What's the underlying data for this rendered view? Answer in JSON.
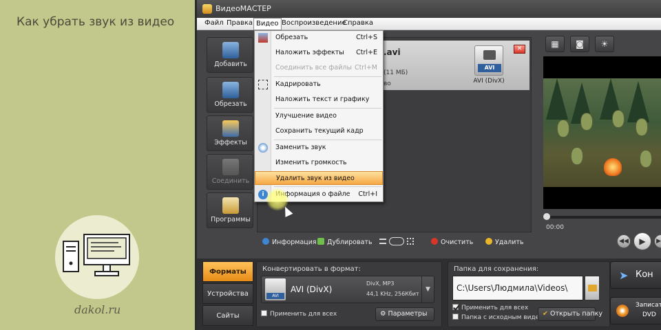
{
  "page": {
    "heading": "Как убрать звук из видео",
    "site": "dakol.ru"
  },
  "window": {
    "title": "ВидеоМАСТЕР"
  },
  "menubar": {
    "items": [
      "Файл",
      "Правка",
      "Видео",
      "Воспроизведение",
      "Справка"
    ],
    "active": "Видео"
  },
  "toolbar": {
    "buttons": [
      {
        "label": "Добавить",
        "icon": "add-film-icon",
        "enabled": true
      },
      {
        "label": "Обрезать",
        "icon": "scissors-film-icon",
        "enabled": true
      },
      {
        "label": "Эффекты",
        "icon": "effects-film-icon",
        "enabled": true
      },
      {
        "label": "Соединить",
        "icon": "join-film-icon",
        "enabled": false
      },
      {
        "label": "Программы",
        "icon": "programs-icon",
        "enabled": true
      }
    ]
  },
  "file": {
    "name": ".avi",
    "size": "(11 МБ)",
    "extra": "во",
    "format_label": "AVI (DivX)",
    "badge": "AVI"
  },
  "dropdown": {
    "items": [
      {
        "label": "Обрезать",
        "shortcut": "Ctrl+S"
      },
      {
        "label": "Наложить эффекты",
        "shortcut": "Ctrl+E"
      },
      {
        "label": "Соединить все файлы",
        "shortcut": "Ctrl+M",
        "disabled": true
      },
      {
        "label": "Кадрировать",
        "shortcut": ""
      },
      {
        "label": "Наложить текст и графику",
        "shortcut": ""
      },
      {
        "label": "Улучшение видео",
        "shortcut": ""
      },
      {
        "label": "Сохранить текущий кадр",
        "shortcut": ""
      },
      {
        "label": "Заменить звук",
        "shortcut": ""
      },
      {
        "label": "Изменить громкость",
        "shortcut": ""
      },
      {
        "label": "Удалить звук из видео",
        "shortcut": "",
        "highlighted": true
      },
      {
        "label": "Информация о файле",
        "shortcut": "Ctrl+I"
      }
    ]
  },
  "actions": {
    "info": "Информация",
    "duplicate": "Дублировать",
    "clear": "Очистить",
    "delete": "Удалить"
  },
  "player": {
    "time": "00:00"
  },
  "bottom": {
    "tabs": [
      "Форматы",
      "Устройства",
      "Сайты"
    ],
    "active_tab": "Форматы",
    "convert_title": "Конвертировать в формат:",
    "format_name": "AVI (DivX)",
    "format_codec": "DivX, MP3",
    "format_audio": "44,1 KHz, 256Кбит",
    "format_badge": "AVI",
    "apply_all": "Применить для всех",
    "params": "Параметры",
    "save_title": "Папка для сохранения:",
    "path": "C:\\Users\\Людмила\\Videos\\",
    "apply_all_2": "Применить для всех",
    "source_folder": "Папка с исходным видео",
    "open_folder": "Открыть папку",
    "convert_button": "Кон",
    "burn_button_line1": "Записат",
    "burn_button_line2": "DVD"
  },
  "colors": {
    "accent": "#f6a744",
    "window_bg": "#3a3a3c",
    "panel_bg": "#c2c78b"
  }
}
